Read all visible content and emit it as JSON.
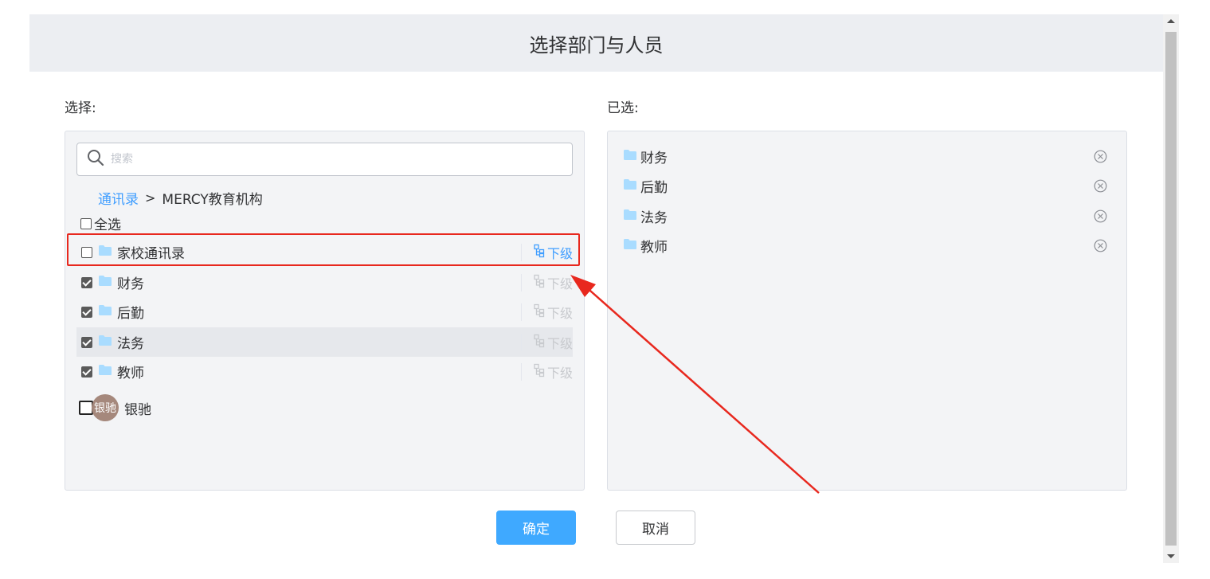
{
  "dialog": {
    "title": "选择部门与人员"
  },
  "left": {
    "label": "选择:",
    "search": {
      "placeholder": "搜索",
      "value": ""
    },
    "breadcrumb": {
      "root": "通讯录",
      "separator": ">",
      "current": "MERCY教育机构"
    },
    "select_all": {
      "label": "全选",
      "checked": false
    },
    "sub_label": "下级",
    "items": [
      {
        "name": "家校通讯录",
        "checked": false
      },
      {
        "name": "财务",
        "checked": true
      },
      {
        "name": "后勤",
        "checked": true
      },
      {
        "name": "法务",
        "checked": true
      },
      {
        "name": "教师",
        "checked": true
      }
    ],
    "user": {
      "avatar_text": "银驰",
      "name": "银驰",
      "checked": false
    }
  },
  "right": {
    "label": "已选:",
    "items": [
      {
        "name": "财务"
      },
      {
        "name": "后勤"
      },
      {
        "name": "法务"
      },
      {
        "name": "教师"
      }
    ]
  },
  "buttons": {
    "confirm": "确定",
    "cancel": "取消"
  },
  "colors": {
    "accent": "#409eff",
    "primary_button": "#3fa9ff",
    "annotation": "#e8281e",
    "folder": "#a9dcff"
  }
}
